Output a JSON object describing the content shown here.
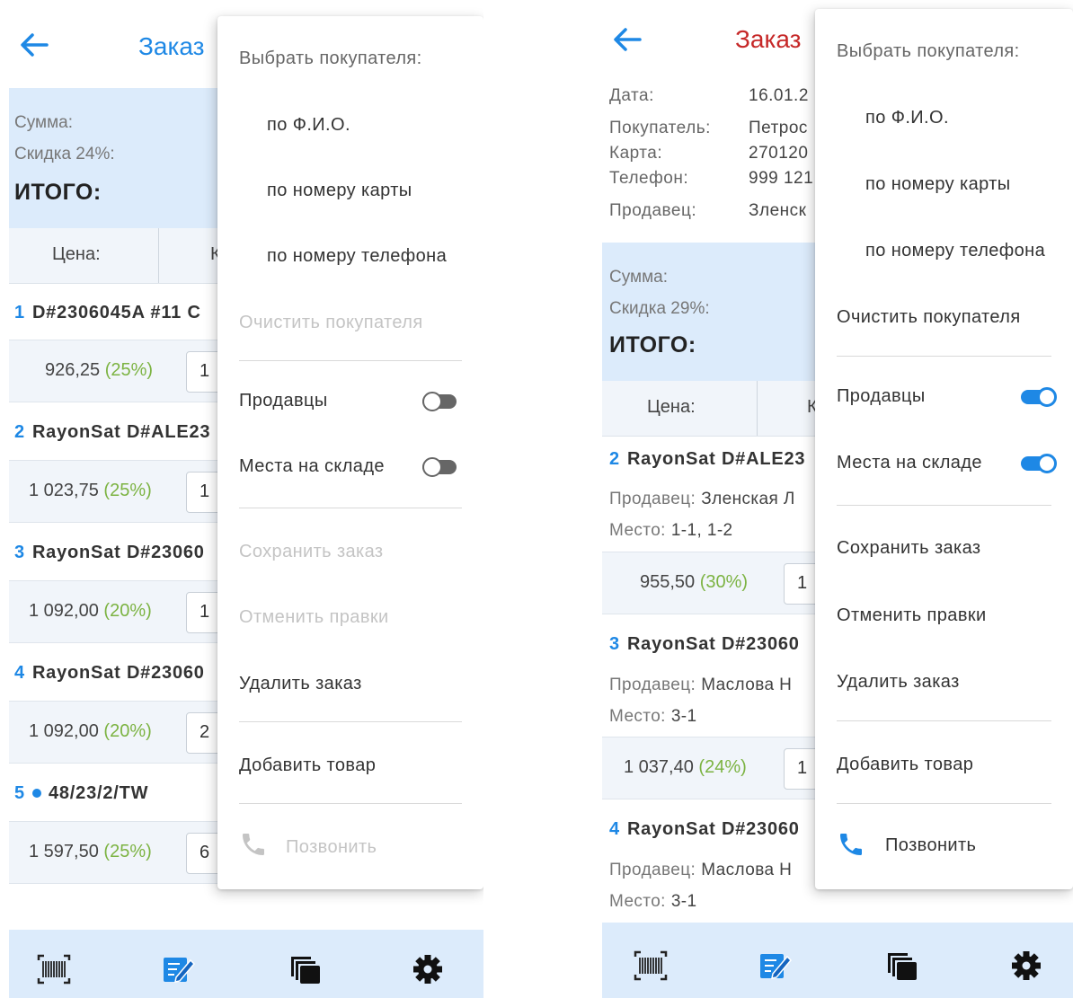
{
  "left": {
    "title": "Заказ",
    "summary": {
      "sum_label": "Сумма:",
      "discount_label": "Скидка 24%:",
      "total_label": "ИТОГО:"
    },
    "columns": {
      "price": "Цена:",
      "qty_partial": "К"
    },
    "items": [
      {
        "num": "1",
        "name": "D#2306045A #11 C",
        "price": "926,25",
        "pct": "(25%)",
        "qty": "1",
        "dot": false
      },
      {
        "num": "2",
        "name": "RayonSat D#ALE23",
        "price": "1 023,75",
        "pct": "(25%)",
        "qty": "1",
        "dot": false
      },
      {
        "num": "3",
        "name": "RayonSat D#23060",
        "price": "1 092,00",
        "pct": "(20%)",
        "qty": "1",
        "dot": false
      },
      {
        "num": "4",
        "name": "RayonSat D#23060",
        "price": "1 092,00",
        "pct": "(20%)",
        "qty": "2",
        "dot": false
      },
      {
        "num": "5",
        "name": "48/23/2/TW",
        "price": "1 597,50",
        "pct": "(25%)",
        "qty": "6",
        "dot": true
      }
    ],
    "menu": {
      "header": "Выбрать покупателя:",
      "by_name": "по Ф.И.О.",
      "by_card": "по номеру карты",
      "by_phone": "по номеру телефона",
      "clear": "Очистить покупателя",
      "sellers": "Продавцы",
      "sellers_on": false,
      "places": "Места на складе",
      "places_on": false,
      "save": "Сохранить заказ",
      "cancel": "Отменить правки",
      "delete": "Удалить заказ",
      "add": "Добавить товар",
      "call": "Позвонить"
    }
  },
  "right": {
    "title": "Заказ",
    "info": [
      {
        "label": "Дата:",
        "value": "16.01.2"
      },
      {
        "label": "Покупатель:",
        "value": "Петрос"
      },
      {
        "label": "Карта:",
        "value": "270120"
      },
      {
        "label": "Телефон:",
        "value": "999 121"
      },
      {
        "label": "Продавец:",
        "value": "Зленск"
      }
    ],
    "summary": {
      "sum_label": "Сумма:",
      "discount_label": "Скидка 29%:",
      "total_label": "ИТОГО:"
    },
    "columns": {
      "price": "Цена:",
      "qty_partial": "К"
    },
    "items": [
      {
        "num": "2",
        "name": "RayonSat D#ALE23",
        "seller_label": "Продавец:",
        "seller": "Зленская Л",
        "place_label": "Место:",
        "place": "1-1, 1-2",
        "price": "955,50",
        "pct": "(30%)",
        "qty": "1"
      },
      {
        "num": "3",
        "name": "RayonSat D#23060",
        "seller_label": "Продавец:",
        "seller": "Маслова Н",
        "place_label": "Место:",
        "place": "3-1",
        "price": "1 037,40",
        "pct": "(24%)",
        "qty": "1"
      },
      {
        "num": "4",
        "name": "RayonSat D#23060",
        "seller_label": "Продавец:",
        "seller": "Маслова Н",
        "place_label": "Место:",
        "place": "3-1"
      }
    ],
    "menu": {
      "header": "Выбрать покупателя:",
      "by_name": "по Ф.И.О.",
      "by_card": "по номеру карты",
      "by_phone": "по номеру телефона",
      "clear": "Очистить покупателя",
      "sellers": "Продавцы",
      "sellers_on": true,
      "places": "Места на складе",
      "places_on": true,
      "save": "Сохранить заказ",
      "cancel": "Отменить правки",
      "delete": "Удалить заказ",
      "add": "Добавить товар",
      "call": "Позвонить"
    }
  },
  "colors": {
    "accent": "#1e88e5",
    "title_red": "#c62828",
    "summary_bg": "#dcebfb",
    "discount_green": "#7cb342"
  },
  "icons": [
    "arrow-back-icon",
    "barcode-icon",
    "edit-icon",
    "copy-icon",
    "settings-icon",
    "phone-icon"
  ]
}
